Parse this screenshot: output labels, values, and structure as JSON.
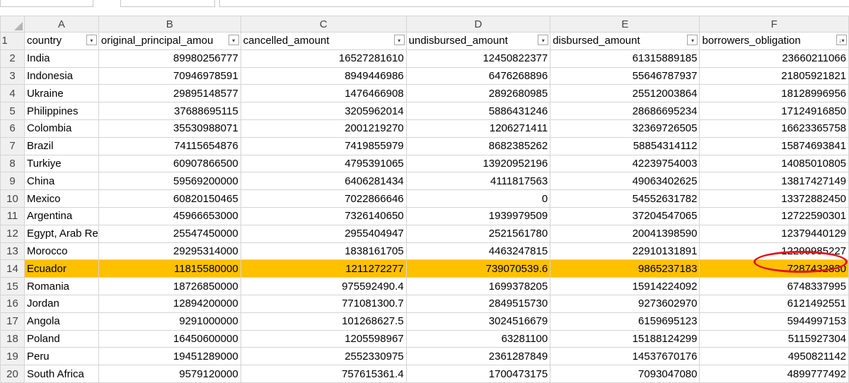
{
  "columns": [
    "A",
    "B",
    "C",
    "D",
    "E",
    "F"
  ],
  "header_row": [
    "country",
    "original_principal_amou",
    "cancelled_amount",
    "undisbursed_amount",
    "disbursed_amount",
    "borrowers_obligation"
  ],
  "filter_icons": [
    "▾",
    "▾",
    "▾",
    "▾",
    "▾",
    "↓▾"
  ],
  "rows": [
    {
      "num": "2",
      "cells": [
        "India",
        "89980256777",
        "16527281610",
        "12450822377",
        "61315889185",
        "23660211066"
      ]
    },
    {
      "num": "3",
      "cells": [
        "Indonesia",
        "70946978591",
        "8949446986",
        "6476268896",
        "55646787937",
        "21805921821"
      ]
    },
    {
      "num": "4",
      "cells": [
        "Ukraine",
        "29895148577",
        "1476466908",
        "2892680985",
        "25512003864",
        "18128996956"
      ]
    },
    {
      "num": "5",
      "cells": [
        "Philippines",
        "37688695115",
        "3205962014",
        "5886431246",
        "28686695234",
        "17124916850"
      ]
    },
    {
      "num": "6",
      "cells": [
        "Colombia",
        "35530988071",
        "2001219270",
        "1206271411",
        "32369726505",
        "16623365758"
      ]
    },
    {
      "num": "7",
      "cells": [
        "Brazil",
        "74115654876",
        "7419855979",
        "8682385262",
        "58854314112",
        "15874693841"
      ]
    },
    {
      "num": "8",
      "cells": [
        "Turkiye",
        "60907866500",
        "4795391065",
        "13920952196",
        "42239754003",
        "14085010805"
      ]
    },
    {
      "num": "9",
      "cells": [
        "China",
        "59569200000",
        "6406281434",
        "4111817563",
        "49063402625",
        "13817427149"
      ]
    },
    {
      "num": "10",
      "cells": [
        "Mexico",
        "60820150465",
        "7022866646",
        "0",
        "54552631782",
        "13372882450"
      ]
    },
    {
      "num": "11",
      "cells": [
        "Argentina",
        "45966653000",
        "7326140650",
        "1939979509",
        "37204547065",
        "12722590301"
      ]
    },
    {
      "num": "12",
      "cells": [
        "Egypt, Arab Re",
        "25547450000",
        "2955404947",
        "2521561780",
        "20041398590",
        "12379440129"
      ]
    },
    {
      "num": "13",
      "cells": [
        "Morocco",
        "29295314000",
        "1838161705",
        "4463247815",
        "22910131891",
        "12299985227"
      ]
    },
    {
      "num": "14",
      "cells": [
        "Ecuador",
        "11815580000",
        "1211272277",
        "739070539.6",
        "9865237183",
        "7287432830"
      ],
      "highlight": true
    },
    {
      "num": "15",
      "cells": [
        "Romania",
        "18726850000",
        "975592490.4",
        "1699378205",
        "15914224092",
        "6748337995"
      ]
    },
    {
      "num": "16",
      "cells": [
        "Jordan",
        "12894200000",
        "771081300.7",
        "2849515730",
        "9273602970",
        "6121492551"
      ]
    },
    {
      "num": "17",
      "cells": [
        "Angola",
        "9291000000",
        "101268627.5",
        "3024516679",
        "6159695123",
        "5944997153"
      ]
    },
    {
      "num": "18",
      "cells": [
        "Poland",
        "16450600000",
        "1205598967",
        "63281100",
        "15188124299",
        "5115927304"
      ]
    },
    {
      "num": "19",
      "cells": [
        "Peru",
        "19451289000",
        "2552330975",
        "2361287849",
        "14537670176",
        "4950821142"
      ]
    },
    {
      "num": "20",
      "cells": [
        "South Africa",
        "9579120000",
        "757615361.4",
        "1700473175",
        "7093047080",
        "4899777492"
      ]
    }
  ],
  "colors": {
    "highlight": "#ffc000",
    "circle": "#e3141b"
  }
}
